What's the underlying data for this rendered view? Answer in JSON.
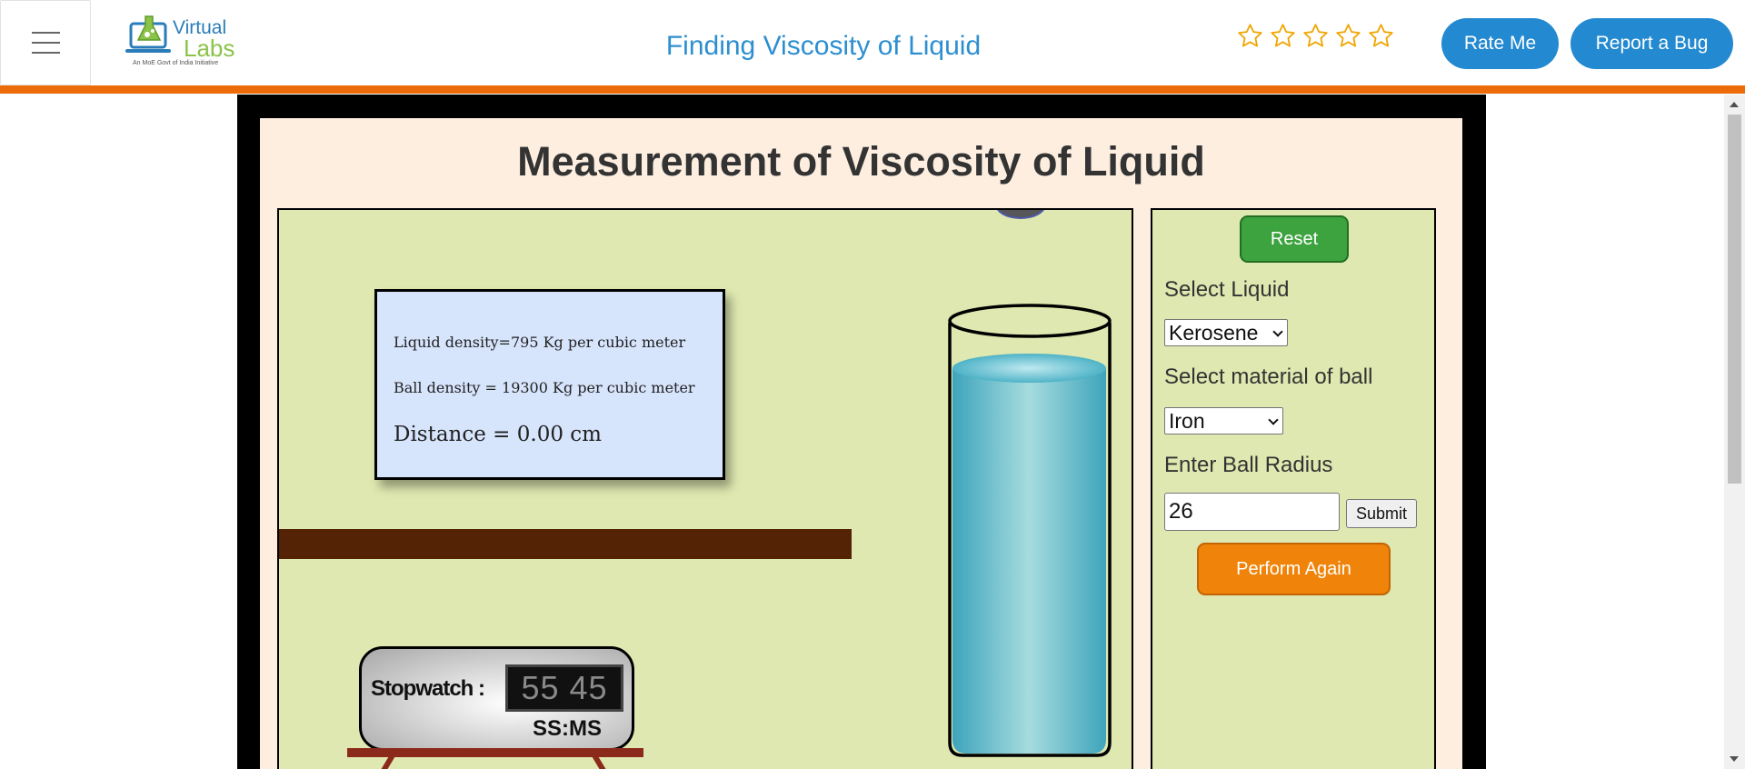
{
  "header": {
    "menu_icon": "hamburger-menu-icon",
    "logo": {
      "top": "Virtual",
      "bottom": "Labs",
      "tagline": "An MoE Govt of India Initiative"
    },
    "title": "Finding Viscosity of Liquid",
    "rating": {
      "max": 5,
      "value": 0,
      "icon": "star-outline-icon"
    },
    "rate_label": "Rate Me",
    "bug_label": "Report a Bug"
  },
  "colors": {
    "accent_blue": "#2389d0",
    "orange_bar": "#ec6c0a",
    "panel_green": "#dfe8b0",
    "reset_green": "#3da33f",
    "perform_orange": "#f0840a"
  },
  "simulation": {
    "title": "Measurement of Viscosity of Liquid",
    "info": {
      "liquid_density": "Liquid density=795 Kg per cubic meter",
      "ball_density": "Ball density = 19300 Kg per cubic meter",
      "distance": "Distance = 0.00 cm"
    },
    "stopwatch": {
      "label": "Stopwatch :",
      "value": "55 45",
      "unit": "SS:MS"
    }
  },
  "controls": {
    "reset_label": "Reset",
    "liquid_label": "Select Liquid",
    "liquid_selected": "Kerosene",
    "ball_label": "Select material of ball",
    "ball_selected": "Iron",
    "radius_label": "Enter Ball Radius",
    "radius_value": "26",
    "submit_label": "Submit",
    "perform_label": "Perform Again"
  }
}
